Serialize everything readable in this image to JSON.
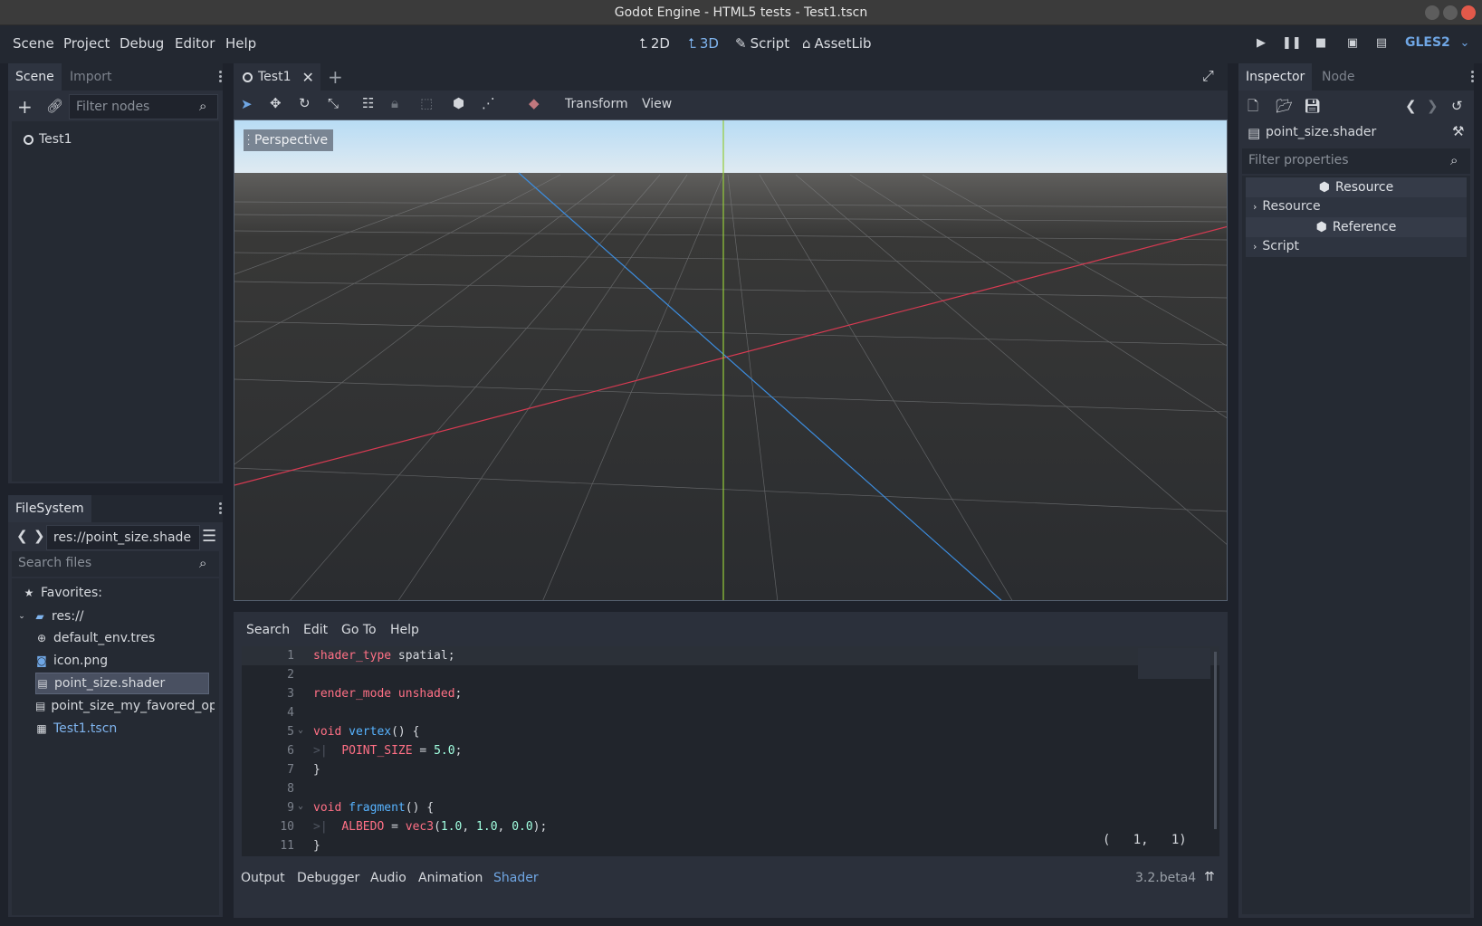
{
  "window": {
    "title": "Godot Engine - HTML5 tests - Test1.tscn"
  },
  "menus": [
    "Scene",
    "Project",
    "Debug",
    "Editor",
    "Help"
  ],
  "workspaces": [
    {
      "label": "2D",
      "icon": "2d-icon"
    },
    {
      "label": "3D",
      "icon": "3d-icon",
      "active": true
    },
    {
      "label": "Script",
      "icon": "script-icon"
    },
    {
      "label": "AssetLib",
      "icon": "assetlib-icon"
    }
  ],
  "renderer": "GLES2",
  "scene_dock": {
    "tabs": [
      "Scene",
      "Import"
    ],
    "filter_placeholder": "Filter nodes",
    "tree": [
      {
        "label": "Test1",
        "icon": "node3d-icon"
      }
    ]
  },
  "filesystem_dock": {
    "tab": "FileSystem",
    "path": "res://point_size.shade",
    "search_placeholder": "Search files",
    "favorites_label": "Favorites:",
    "root_label": "res://",
    "files": [
      {
        "label": "default_env.tres",
        "icon": "environment-icon"
      },
      {
        "label": "icon.png",
        "icon": "image-icon"
      },
      {
        "label": "point_size.shader",
        "icon": "shader-file-icon",
        "selected": true
      },
      {
        "label": "point_size_my_favored_op",
        "icon": "shader-file-icon"
      },
      {
        "label": "Test1.tscn",
        "icon": "scene-file-icon",
        "highlight": true
      }
    ]
  },
  "scene_tabs": {
    "current": "Test1"
  },
  "viewport_toolbar": {
    "transform_label": "Transform",
    "view_label": "View"
  },
  "viewport": {
    "perspective_label": "Perspective"
  },
  "script_editor": {
    "menus": [
      "Search",
      "Edit",
      "Go To",
      "Help"
    ],
    "cursor_position": "(   1,   1)",
    "lines": [
      {
        "n": "1",
        "text": "shader_type spatial;"
      },
      {
        "n": "2",
        "text": ""
      },
      {
        "n": "3",
        "text": "render_mode unshaded;"
      },
      {
        "n": "4",
        "text": ""
      },
      {
        "n": "5",
        "text": "void vertex() {"
      },
      {
        "n": "6",
        "text": "POINT_SIZE = 5.0;"
      },
      {
        "n": "7",
        "text": "}"
      },
      {
        "n": "8",
        "text": ""
      },
      {
        "n": "9",
        "text": "void fragment() {"
      },
      {
        "n": "10",
        "text": "ALBEDO = vec3(1.0, 1.0, 0.0);"
      },
      {
        "n": "11",
        "text": "}"
      }
    ]
  },
  "bottom_panel": {
    "tabs": [
      "Output",
      "Debugger",
      "Audio",
      "Animation",
      "Shader"
    ],
    "active_tab": "Shader",
    "version": "3.2.beta4"
  },
  "inspector": {
    "tabs": [
      "Inspector",
      "Node"
    ],
    "resource_name": "point_size.shader",
    "filter_placeholder": "Filter properties",
    "sections": [
      {
        "header": "Resource",
        "row": "Resource"
      },
      {
        "header": "Reference",
        "row": "Script"
      }
    ]
  },
  "colors": {
    "accent": "#6fa6e4",
    "x_axis": "#d83a52",
    "y_axis": "#94cc3a",
    "z_axis": "#3c8ddf"
  }
}
